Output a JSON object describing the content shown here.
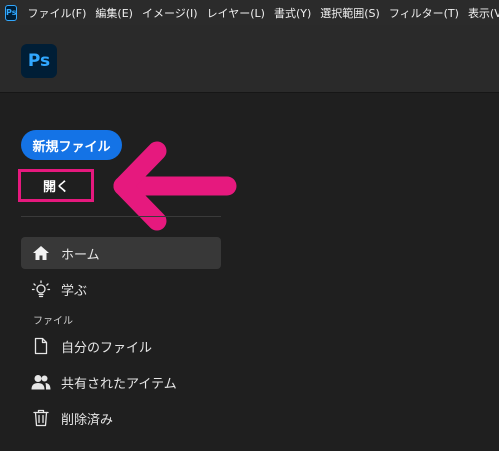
{
  "menubar": {
    "logo_text": "Ps",
    "items": [
      "ファイル(F)",
      "編集(E)",
      "イメージ(I)",
      "レイヤー(L)",
      "書式(Y)",
      "選択範囲(S)",
      "フィルター(T)",
      "表示(V)"
    ]
  },
  "header": {
    "logo_text": "Ps"
  },
  "home": {
    "new_file_label": "新規ファイル",
    "open_label": "開く",
    "annotation_color": "#e6197e",
    "accent_color": "#1473e6"
  },
  "nav": {
    "home_label": "ホーム",
    "learn_label": "学ぶ",
    "files_section_label": "ファイル",
    "my_files_label": "自分のファイル",
    "shared_label": "共有されたアイテム",
    "deleted_label": "削除済み"
  }
}
